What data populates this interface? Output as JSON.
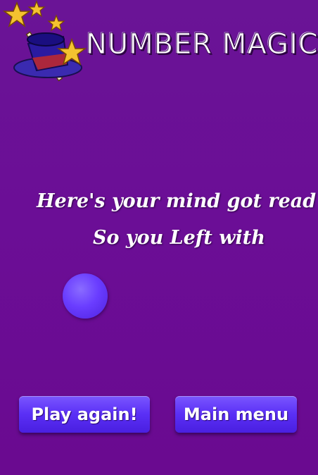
{
  "app": {
    "title": "NUMBER MAGIC",
    "logo_icon": "magic-hat-with-stars"
  },
  "message": {
    "line1": "Here's your mind got read",
    "line2": "So you Left with"
  },
  "result": {
    "icon": "purple-ball"
  },
  "buttons": {
    "play_again": "Play again!",
    "main_menu": "Main menu"
  },
  "colors": {
    "background": "#6b0e96",
    "button": "#5a2ff5",
    "ball": "#6a3dff",
    "text": "#ffffff"
  }
}
